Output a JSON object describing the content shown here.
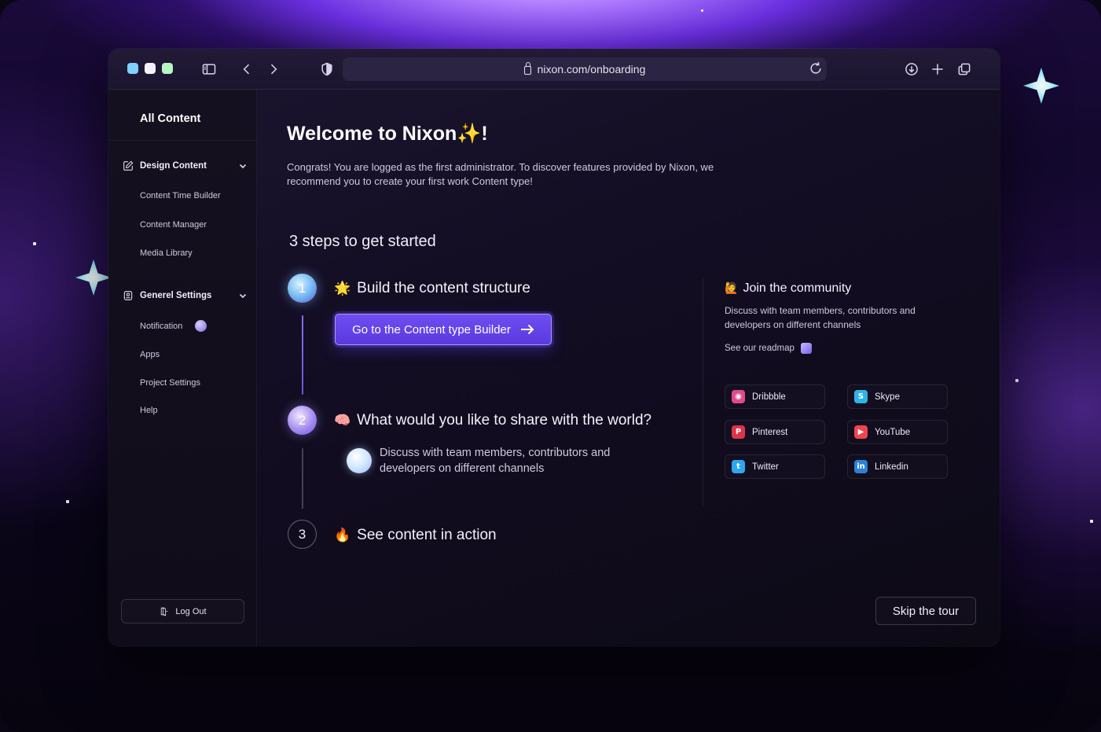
{
  "browser": {
    "url": "nixon.com/onboarding",
    "traffic_colors": [
      "#7fd0ff",
      "#f4f2ff",
      "#b9f3c6"
    ]
  },
  "sidebar": {
    "title": "All Content",
    "sections": [
      {
        "label": "Design Content",
        "icon": "edit-icon",
        "items": [
          "Content Time Builder",
          "Content Manager",
          "Media Library"
        ]
      },
      {
        "label": "Generel Settings",
        "icon": "settings-icon",
        "items": [
          "Notification",
          "Apps",
          "Project Settings",
          "Help"
        ]
      }
    ],
    "logout_label": "Log Out"
  },
  "main": {
    "welcome": "Welcome to Nixon✨!",
    "intro": "Congrats! You are logged as the first administrator. To discover features provided by Nixon, we recommend you to create your first work Content type!",
    "steps_title": "3 steps to get started",
    "steps": [
      {
        "number": "1",
        "emoji": "🌟",
        "title": "Build the content structure"
      },
      {
        "number": "2",
        "emoji": "🧠",
        "title": "What would you like to share with the world?"
      },
      {
        "number": "3",
        "emoji": "🔥",
        "title": "See content in action"
      }
    ],
    "cta_label": "Go to the Content type Builder",
    "discuss_text": "Discuss with team members, contributors and developers on different channels",
    "skip_label": "Skip the tour"
  },
  "community": {
    "emoji": "🙋",
    "title": "Join the community",
    "description": "Discuss with team members, contributors and developers on different channels",
    "roadmap_label": "See our readmap",
    "channels": [
      {
        "name": "Dribbble",
        "icon": "dribbble-icon",
        "color": "#e14b8a"
      },
      {
        "name": "Skype",
        "icon": "skype-icon",
        "color": "#2fb4e8"
      },
      {
        "name": "Pinterest",
        "icon": "pinterest-icon",
        "color": "#e0334a"
      },
      {
        "name": "YouTube",
        "icon": "youtube-icon",
        "color": "#f0454d"
      },
      {
        "name": "Twitter",
        "icon": "twitter-icon",
        "color": "#2fa6f0"
      },
      {
        "name": "Linkedin",
        "icon": "linkedin-icon",
        "color": "#2e80d6"
      }
    ]
  },
  "colors": {
    "accent": "#6e4ef0",
    "accent_border": "#a99bff"
  }
}
